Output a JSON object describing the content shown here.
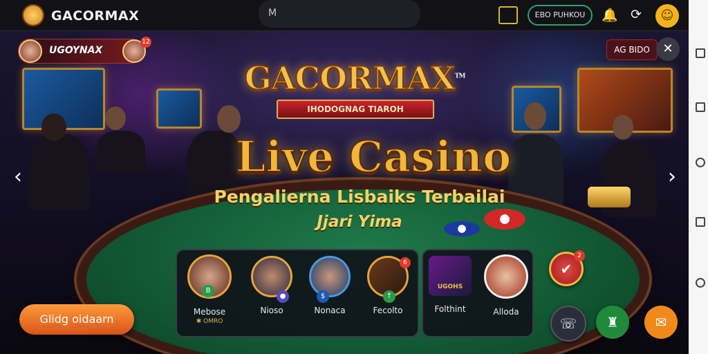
{
  "header": {
    "brand": "GACORMAX",
    "search_text": "M",
    "login_label": "EBO PUHKOU"
  },
  "hero": {
    "user_name": "UGOYNAX",
    "user_badge": "12",
    "live_chip": "AG BIDO",
    "brand_title": "GACORMAX",
    "brand_tm": "TM",
    "ribbon_text": "IHODOGNAG TIAROH",
    "title": "Live Casino",
    "subtitle_line1": "Pengalierna Lisbaiks Terbailai",
    "subtitle_line2": "Jjari Yima"
  },
  "games": [
    {
      "label": "Mebose",
      "sub": "OMRO",
      "sub_mark": "✱"
    },
    {
      "label": "Nioso"
    },
    {
      "label": "Nonaca"
    },
    {
      "label": "Fecolto",
      "badge": "6"
    },
    {
      "label": "Folthint",
      "sub_logo": "UGOHS"
    },
    {
      "label": "Alloda"
    }
  ],
  "cta_label": "Glidg oidaarn",
  "badges": {
    "fav": "2"
  },
  "colors": {
    "accent_gold": "#f0b73a",
    "cta_orange": "#ef7a2a",
    "login_green": "#2ea36a",
    "fab_green": "#1f8a3a",
    "fab_orange": "#ef8a1a"
  },
  "icons": {
    "gift": "gift-icon",
    "notification": "bell-icon",
    "refresh": "refresh-icon",
    "profile": "user-icon",
    "close": "close-icon",
    "prev": "chevron-left-icon",
    "next": "chevron-right-icon"
  }
}
